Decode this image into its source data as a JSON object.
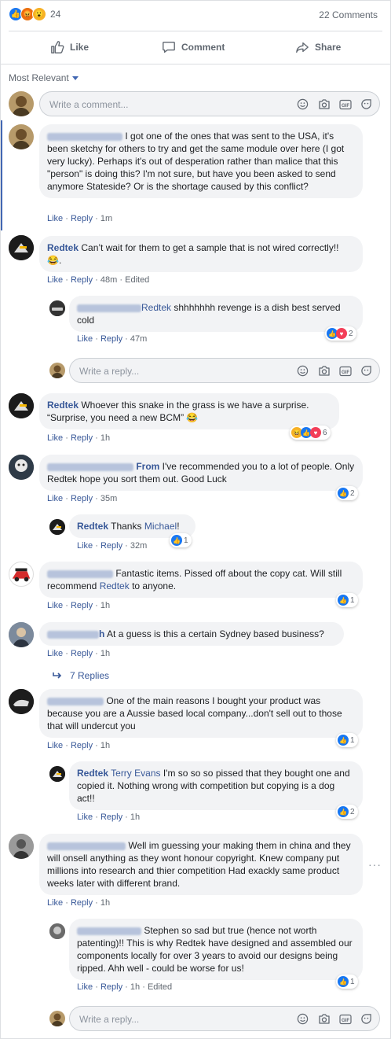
{
  "summary": {
    "reaction_count": "24",
    "comments_count": "22 Comments"
  },
  "actions": {
    "like": "Like",
    "comment": "Comment",
    "share": "Share"
  },
  "sort_label": "Most Relevant",
  "composer": {
    "comment_placeholder": "Write a comment...",
    "reply_placeholder": "Write a reply..."
  },
  "meta": {
    "like": "Like",
    "reply": "Reply",
    "sep": "·",
    "edited": "Edited"
  },
  "comments": [
    {
      "text": " I got one of the ones that was sent to the USA, it's been sketchy for others to try and get the same module over here (I got very lucky). Perhaps it's out of desperation rather than malice that this \"person\" is doing this? I'm not sure, but have you been asked to send anymore Stateside? Or is the shortage caused by this conflict?",
      "time": "1m"
    },
    {
      "name": "Redtek",
      "text": " Can’t wait for them to get a sample that is not wired correctly!! 😂.",
      "time": "48m"
    },
    {
      "mention": "Redtek",
      "text": " shhhhhhh revenge is a dish best served cold",
      "time": "47m",
      "count": "2"
    },
    {
      "name": "Redtek",
      "text": " Whoever this snake in the grass is we have a surprise. “Surprise, you need a new BCM” 😂",
      "time": "1h",
      "count": "6"
    },
    {
      "name_suffix": "From",
      "text": " I've recommended you to a lot of people. Only Redtek hope you sort them out. Good Luck",
      "time": "35m",
      "count": "2"
    },
    {
      "name": "Redtek",
      "text": " Thanks ",
      "mention": "Michael",
      "text_end": "!",
      "time": "32m",
      "count": "1"
    },
    {
      "text": " Fantastic items. Pissed off about the copy cat. Will still recommend ",
      "mention": "Redtek",
      "text_end": " to anyone.",
      "time": "1h",
      "count": "1"
    },
    {
      "name_suffix": "h",
      "text": " At a guess is this a certain Sydney based business?",
      "time": "1h"
    },
    {
      "text": " One of the main reasons I bought your product was because you are a Aussie based local company...don't sell out to those that will undercut you",
      "time": "1h",
      "count": "1"
    },
    {
      "name": "Redtek",
      "mention": "Terry Evans",
      "text": " I'm so so so pissed that they bought one and copied it. Nothing wrong with competition but copying is a dog act!!",
      "time": "1h",
      "count": "2"
    },
    {
      "text": " Well im guessing your making them in china and they will onsell anything as they wont honour copyright. Knew company put millions into research and thier competition Had exackly same product weeks later with different brand.",
      "time": "1h"
    },
    {
      "text": " Stephen so sad but true (hence not worth patenting)!! This is why Redtek have designed and assembled our components locally for over 3 years to avoid our designs being ripped. Ahh well - could be worse for us!",
      "time": "1h",
      "count": "1"
    }
  ],
  "view_replies": "7 Replies",
  "colors": {
    "link": "#385898",
    "bubble": "#f2f3f5",
    "like": "#1877f2",
    "love": "#f33e58",
    "haha": "#f7b125"
  }
}
